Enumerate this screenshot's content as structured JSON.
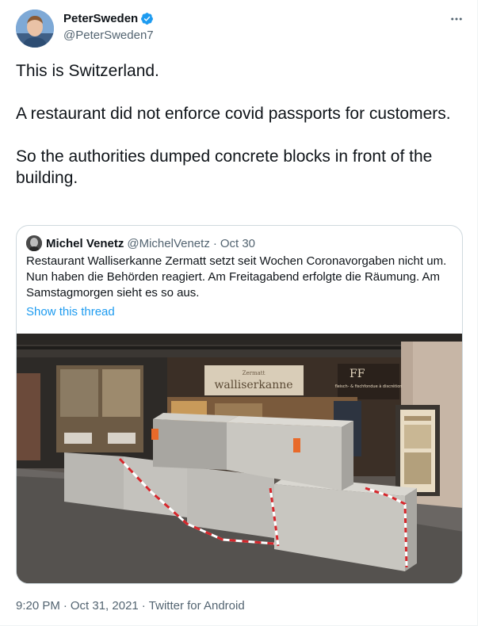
{
  "author": {
    "display_name": "PeterSweden",
    "handle": "@PeterSweden7"
  },
  "tweet": {
    "paragraphs": [
      "This is Switzerland.",
      "A restaurant did not enforce covid passports for customers.",
      "So the authorities dumped concrete blocks in front of the building."
    ]
  },
  "quoted": {
    "display_name": "Michel Venetz",
    "handle": "@MichelVenetz",
    "separator": "·",
    "date": "Oct 30",
    "text": "Restaurant Walliserkanne Zermatt setzt seit Wochen Coronavorgaben nicht um. Nun haben die Behörden reagiert. Am Freitagabend erfolgte die Räumung. Am Samstagmorgen sieht es so aus.",
    "show_thread": "Show this thread",
    "photo": {
      "sign_text": "walliserkanne",
      "sign_small": "Zermatt",
      "shop_text": "FF",
      "shop_sub": "fleisch- & fischfondue\nà discrétion"
    }
  },
  "meta": {
    "time": "9:20 PM",
    "separator": "·",
    "date": "Oct 31, 2021",
    "source": "Twitter for Android"
  },
  "colors": {
    "verified": "#1d9bf0",
    "link": "#1d9bf0",
    "muted": "#536471",
    "border": "#cfd9de"
  },
  "icons": {
    "verified": "verified-badge-icon",
    "more": "more-options-icon"
  }
}
